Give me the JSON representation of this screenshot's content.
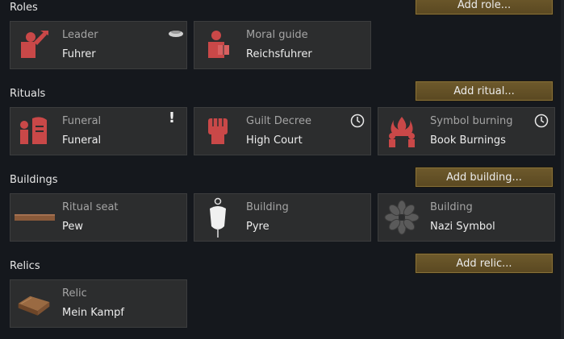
{
  "sections": {
    "roles": {
      "title": "Roles",
      "add_label": "Add role...",
      "cards": [
        {
          "label": "Leader",
          "value": "Fuhrer"
        },
        {
          "label": "Moral guide",
          "value": "Reichsfuhrer"
        }
      ]
    },
    "rituals": {
      "title": "Rituals",
      "add_label": "Add ritual...",
      "cards": [
        {
          "label": "Funeral",
          "value": "Funeral"
        },
        {
          "label": "Guilt Decree",
          "value": "High Court"
        },
        {
          "label": "Symbol burning",
          "value": "Book Burnings"
        }
      ]
    },
    "buildings": {
      "title": "Buildings",
      "add_label": "Add building...",
      "cards": [
        {
          "label": "Ritual seat",
          "value": "Pew"
        },
        {
          "label": "Building",
          "value": "Pyre"
        },
        {
          "label": "Building",
          "value": "Nazi Symbol"
        }
      ]
    },
    "relics": {
      "title": "Relics",
      "add_label": "Add relic...",
      "cards": [
        {
          "label": "Relic",
          "value": "Mein Kampf"
        }
      ]
    }
  },
  "funeral_alert": "!",
  "colors": {
    "background": "#15181d",
    "card": "#2c2d2e",
    "button": "#6e5a2c",
    "icon_red": "#c94848"
  }
}
